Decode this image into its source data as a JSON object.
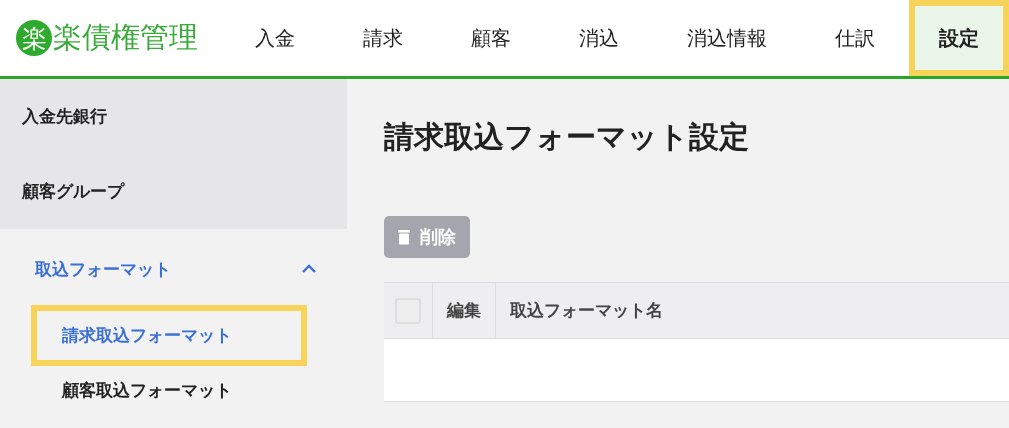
{
  "logo": {
    "mark": "楽",
    "text": "楽債権管理"
  },
  "nav": [
    {
      "label": "入金",
      "selected": false,
      "highlighted": false
    },
    {
      "label": "請求",
      "selected": false,
      "highlighted": false
    },
    {
      "label": "顧客",
      "selected": false,
      "highlighted": false
    },
    {
      "label": "消込",
      "selected": false,
      "highlighted": false
    },
    {
      "label": "消込情報",
      "selected": false,
      "highlighted": false
    },
    {
      "label": "仕訳",
      "selected": false,
      "highlighted": false
    },
    {
      "label": "設定",
      "selected": true,
      "highlighted": true
    }
  ],
  "sidebar": {
    "items": [
      {
        "label": "入金先銀行"
      },
      {
        "label": "顧客グループ"
      },
      {
        "label": "取込フォーマット",
        "selected": true,
        "expanded": true,
        "children": [
          {
            "label": "請求取込フォーマット",
            "selected": true,
            "highlighted": true
          },
          {
            "label": "顧客取込フォーマット",
            "selected": false,
            "highlighted": false
          }
        ]
      }
    ]
  },
  "page_title": "請求取込フォーマット設定",
  "delete_button": {
    "label": "削除",
    "disabled": true
  },
  "table": {
    "columns": [
      {
        "kind": "checkbox",
        "checked": false
      },
      {
        "kind": "text",
        "label": "編集"
      },
      {
        "kind": "text",
        "label": "取込フォーマット名"
      }
    ]
  }
}
